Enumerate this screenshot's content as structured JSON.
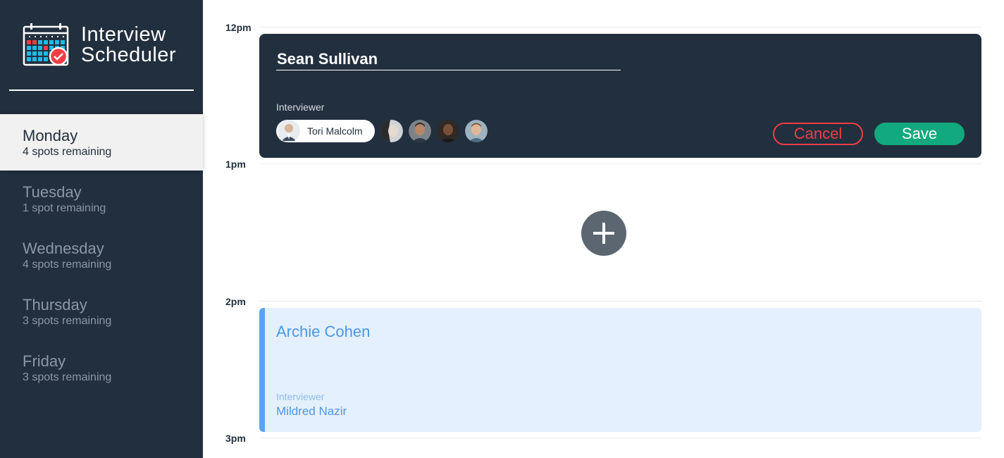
{
  "app": {
    "title_line1": "Interview",
    "title_line2": "Scheduler"
  },
  "days": [
    {
      "name": "Monday",
      "spots": "4 spots remaining",
      "selected": true
    },
    {
      "name": "Tuesday",
      "spots": "1 spot remaining",
      "selected": false
    },
    {
      "name": "Wednesday",
      "spots": "4 spots remaining",
      "selected": false
    },
    {
      "name": "Thursday",
      "spots": "3 spots remaining",
      "selected": false
    },
    {
      "name": "Friday",
      "spots": "3 spots remaining",
      "selected": false
    }
  ],
  "times": [
    "12pm",
    "1pm",
    "2pm",
    "3pm"
  ],
  "edit_form": {
    "student_name": "Sean Sullivan",
    "interviewer_label": "Interviewer",
    "selected_interviewer": "Tori Malcolm",
    "other_interviewers": [
      "interviewer-avatar-2",
      "interviewer-avatar-3",
      "interviewer-avatar-4",
      "interviewer-avatar-5"
    ],
    "cancel_label": "Cancel",
    "save_label": "Save"
  },
  "add_slot": {
    "icon": "plus-icon"
  },
  "appointment": {
    "student_name": "Archie Cohen",
    "interviewer_label": "Interviewer",
    "interviewer_name": "Mildred Nazir"
  },
  "colors": {
    "sidebar_bg": "#222f3e",
    "save": "#12a97e",
    "cancel": "#ef3e44",
    "appointment_bg": "#e4f0fd",
    "appointment_accent": "#5aa4f0"
  }
}
